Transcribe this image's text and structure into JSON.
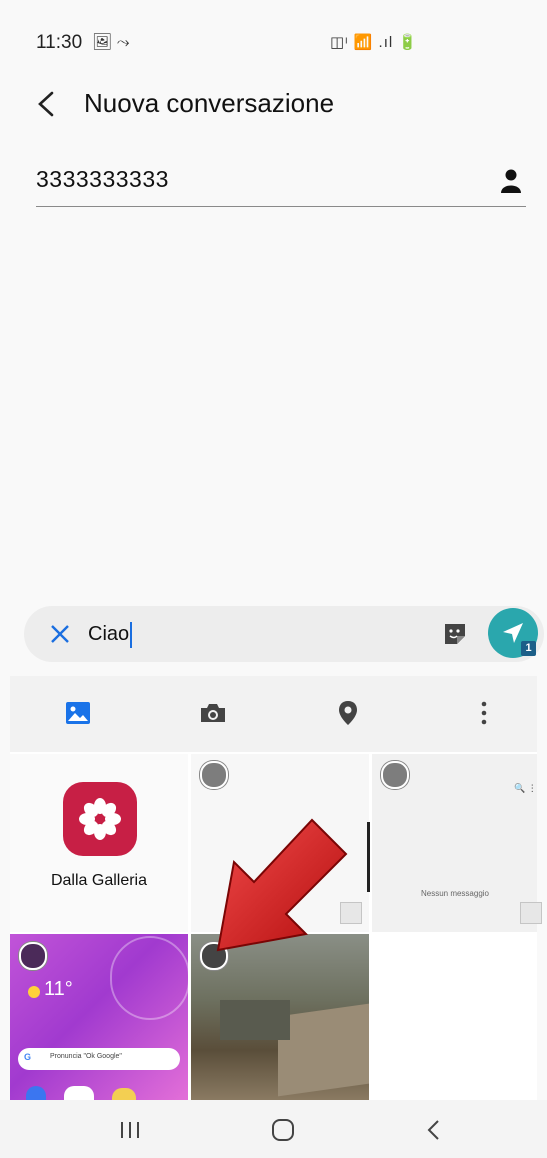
{
  "status_bar": {
    "time": "11:30",
    "left_icons": "🖼 ⤳",
    "right_icons": "◫ᶦ 📶 .ıl 🔋"
  },
  "header": {
    "title": "Nuova conversazione"
  },
  "recipient": {
    "value": "3333333333"
  },
  "composer": {
    "text": "Ciao",
    "send_badge": "1"
  },
  "panel": {
    "gallery_label": "Dalla Galleria",
    "empty_messages_label": "Nessun messaggio",
    "weather_temp": "11°",
    "search_pill": "Pronuncia \"Ok Google\""
  },
  "colors": {
    "accent": "#2aa7ad",
    "gallery_red": "#c71f45",
    "arrow_red": "#d61414"
  }
}
